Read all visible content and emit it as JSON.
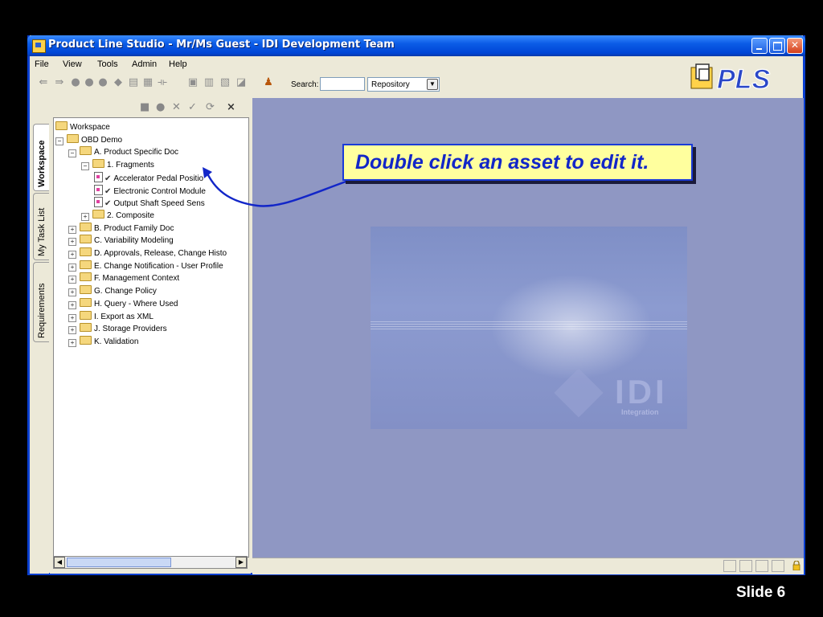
{
  "window": {
    "title": "Product Line Studio - Mr/Ms Guest - IDI Development Team"
  },
  "menu": [
    "File",
    "View",
    "Tools",
    "Admin",
    "Help"
  ],
  "toolbar": {
    "search_label": "Search:",
    "search_value": "",
    "repository_select": "Repository"
  },
  "logo": "PLS",
  "sidebar_tabs": [
    "Workspace",
    "My Task List",
    "Requirements"
  ],
  "tree": [
    {
      "label": "Workspace",
      "depth": 0,
      "type": "folder-open",
      "expander": ""
    },
    {
      "label": "OBD Demo",
      "depth": 0,
      "type": "folder-open",
      "expander": "-"
    },
    {
      "label": "A. Product Specific Doc",
      "depth": 1,
      "type": "folder-open",
      "expander": "-"
    },
    {
      "label": "1. Fragments",
      "depth": 2,
      "type": "folder-open",
      "expander": "-"
    },
    {
      "label": "Accelerator Pedal Positio",
      "depth": 3,
      "type": "doc",
      "expander": ""
    },
    {
      "label": "Electronic Control Module",
      "depth": 3,
      "type": "doc",
      "expander": ""
    },
    {
      "label": "Output Shaft Speed Sens",
      "depth": 3,
      "type": "doc",
      "expander": ""
    },
    {
      "label": "2. Composite",
      "depth": 2,
      "type": "folder",
      "expander": "+"
    },
    {
      "label": "B. Product Family Doc",
      "depth": 1,
      "type": "folder",
      "expander": "+"
    },
    {
      "label": "C. Variability Modeling",
      "depth": 1,
      "type": "folder",
      "expander": "+"
    },
    {
      "label": "D. Approvals, Release, Change Histo",
      "depth": 1,
      "type": "folder",
      "expander": "+"
    },
    {
      "label": "E. Change Notification - User Profile",
      "depth": 1,
      "type": "folder",
      "expander": "+"
    },
    {
      "label": "F. Management Context",
      "depth": 1,
      "type": "folder",
      "expander": "+"
    },
    {
      "label": "G. Change Policy",
      "depth": 1,
      "type": "folder",
      "expander": "+"
    },
    {
      "label": "H. Query - Where Used",
      "depth": 1,
      "type": "folder",
      "expander": "+"
    },
    {
      "label": "I. Export as XML",
      "depth": 1,
      "type": "folder",
      "expander": "+"
    },
    {
      "label": "J. Storage Providers",
      "depth": 1,
      "type": "folder",
      "expander": "+"
    },
    {
      "label": "K. Validation",
      "depth": 1,
      "type": "folder",
      "expander": "+"
    }
  ],
  "splash": {
    "brand": "IDI",
    "subtitle": "Integration"
  },
  "callout": "Double click an asset to edit it.",
  "slide_label": "Slide 6",
  "colors": {
    "titlebar": "#0b5ce6",
    "workspace": "#8f97c3",
    "callout_bg": "#ffff9e",
    "callout_text": "#1226c8"
  }
}
